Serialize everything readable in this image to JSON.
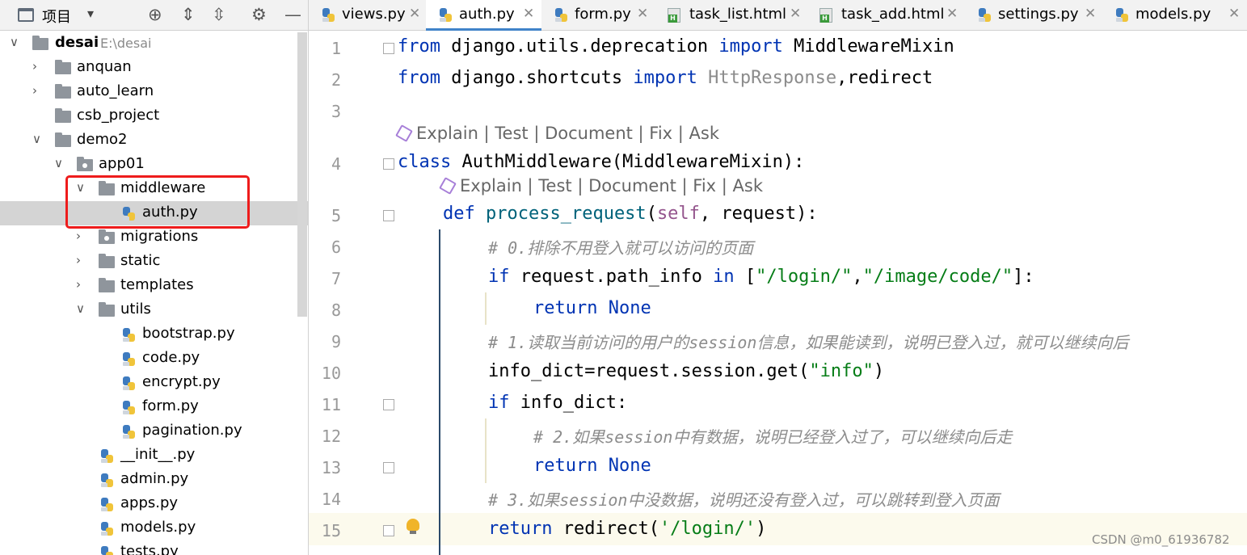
{
  "project_panel": {
    "title": "项目",
    "tree": [
      {
        "label": "desai",
        "path": "E:\\desai"
      },
      {
        "label": "anquan"
      },
      {
        "label": "auto_learn"
      },
      {
        "label": "csb_project"
      },
      {
        "label": "demo2"
      },
      {
        "label": "app01"
      },
      {
        "label": "middleware"
      },
      {
        "label": "auth.py"
      },
      {
        "label": "migrations"
      },
      {
        "label": "static"
      },
      {
        "label": "templates"
      },
      {
        "label": "utils"
      },
      {
        "label": "bootstrap.py"
      },
      {
        "label": "code.py"
      },
      {
        "label": "encrypt.py"
      },
      {
        "label": "form.py"
      },
      {
        "label": "pagination.py"
      },
      {
        "label": "__init__.py"
      },
      {
        "label": "admin.py"
      },
      {
        "label": "apps.py"
      },
      {
        "label": "models.py"
      },
      {
        "label": "tests.py"
      }
    ]
  },
  "tabs": [
    "views.py",
    "auth.py",
    "form.py",
    "task_list.html",
    "task_add.html",
    "settings.py",
    "models.py"
  ],
  "editor": {
    "lens_text": "Explain | Test | Document | Fix | Ask",
    "line_numbers": [
      "1",
      "2",
      "3",
      "4",
      "5",
      "6",
      "7",
      "8",
      "9",
      "10",
      "11",
      "12",
      "13",
      "14",
      "15"
    ],
    "code": {
      "l1": {
        "a": "from",
        "b": " django.utils.deprecation ",
        "c": "import",
        "d": " MiddlewareMixin"
      },
      "l2": {
        "a": "from",
        "b": " django.shortcuts ",
        "c": "import",
        "d": " HttpResponse",
        "e": ",redirect"
      },
      "l4": {
        "a": "class",
        "b": " AuthMiddleware(MiddlewareMixin):"
      },
      "l5": {
        "a": "def",
        "b": "process_request",
        "c": "(",
        "d": "self",
        "e": ", request):"
      },
      "l6": "# 0.排除不用登入就可以访问的页面",
      "l7": {
        "a": "if",
        "b": " request.path_info ",
        "c": "in",
        "d": " [",
        "e": "\"/login/\"",
        "f": ",",
        "g": "\"/image/code/\"",
        "h": "]:"
      },
      "l8": {
        "a": "return",
        "b": "None"
      },
      "l9": "# 1.读取当前访问的用户的session信息，如果能读到，说明已登入过，就可以继续向后",
      "l10": {
        "a": "info_dict=request.session.get(",
        "b": "\"info\"",
        "c": ")"
      },
      "l11": {
        "a": "if",
        "b": " info_dict:"
      },
      "l12": "# 2.如果session中有数据，说明已经登入过了，可以继续向后走",
      "l13": {
        "a": "return",
        "b": "None"
      },
      "l14": "# 3.如果session中没数据，说明还没有登入过，可以跳转到登入页面",
      "l15": {
        "a": "return",
        "b": " redirect(",
        "c": "'/login/'",
        "d": ")"
      }
    }
  },
  "watermark": "CSDN @m0_61936782"
}
